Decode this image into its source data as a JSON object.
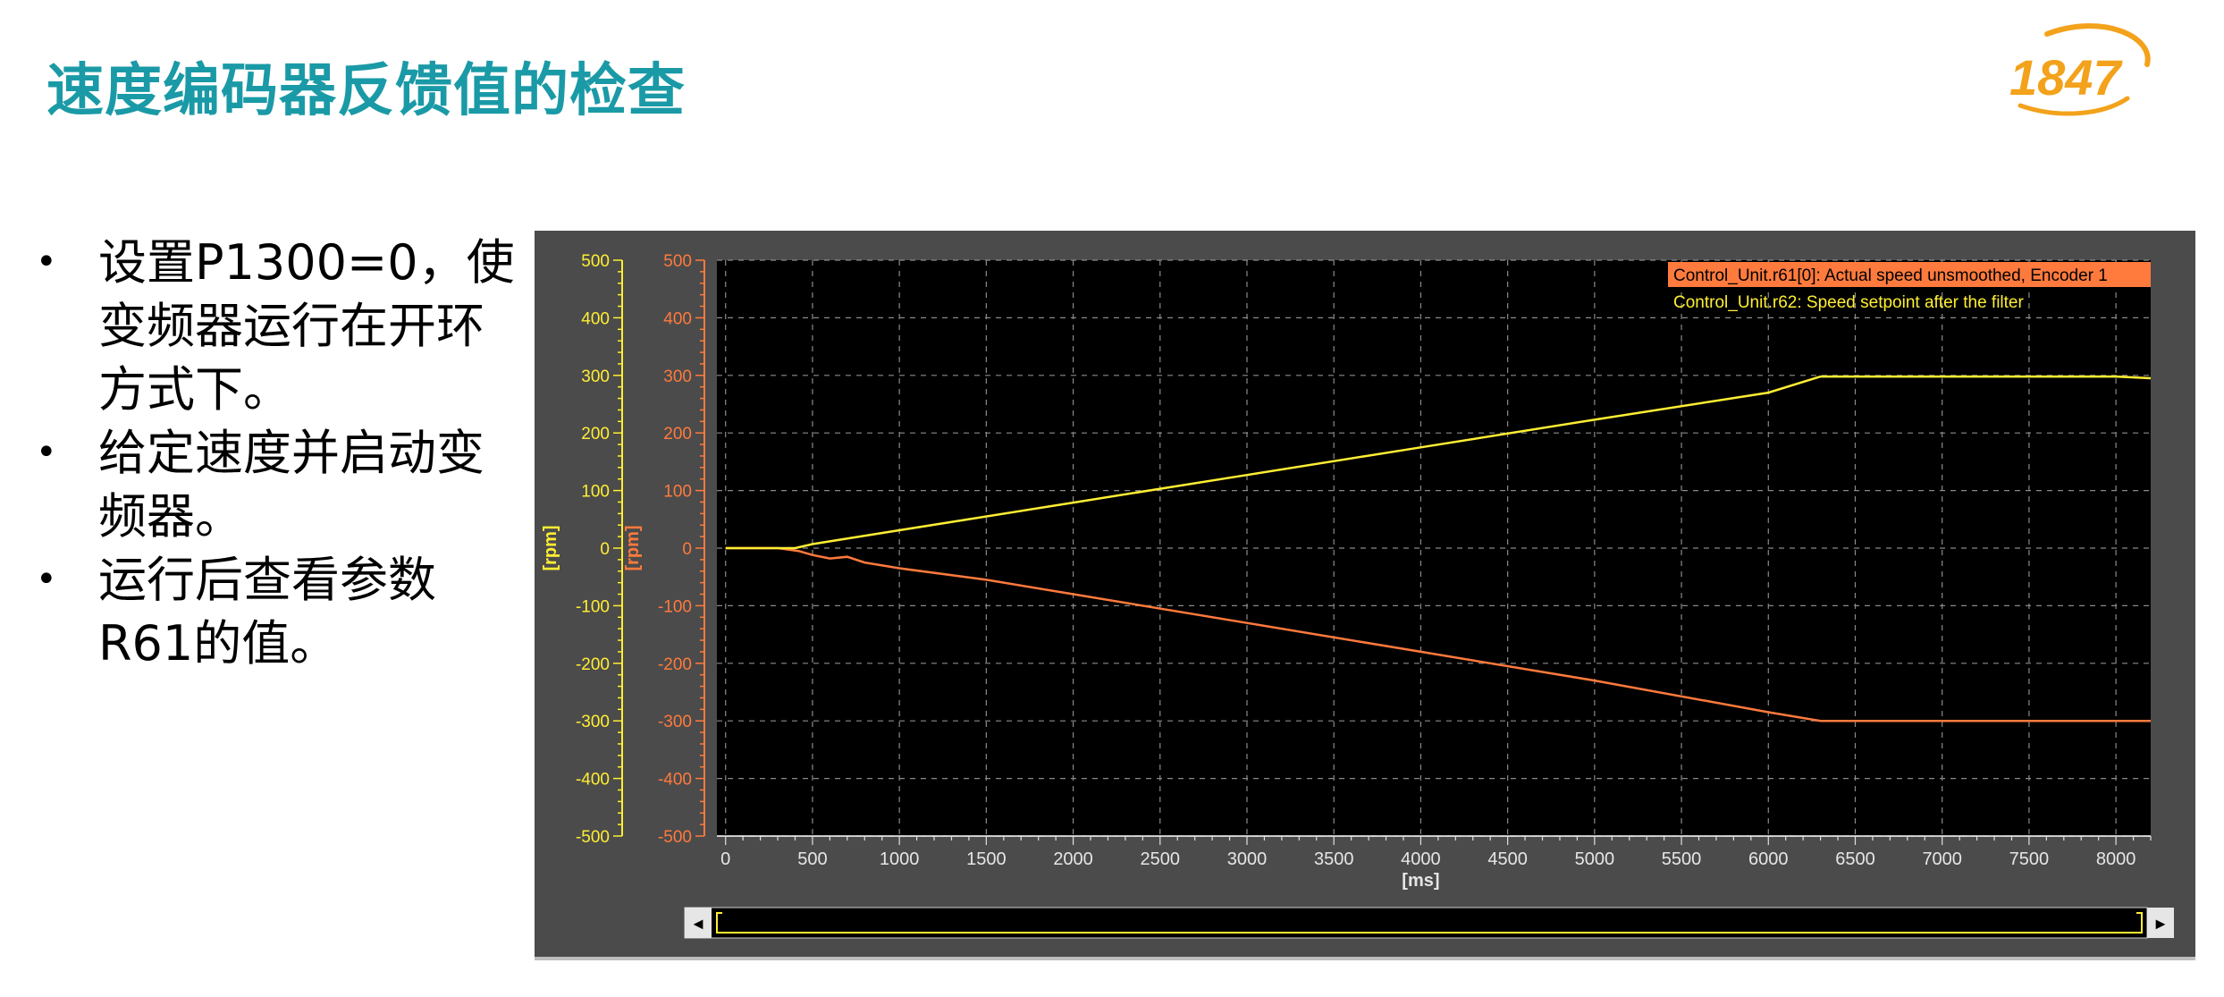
{
  "slide": {
    "title": "速度编码器反馈值的检查",
    "logo_text": "1847"
  },
  "bullets": [
    "设置P1300=0，使变频器运行在开环方式下。",
    "给定速度并启动变频器。",
    "运行后查看参数R61的值。"
  ],
  "bullet_lines": [
    [
      "设置P1300=0，使",
      "变频器运行在开环",
      "方式下。"
    ],
    [
      "给定速度并启动变",
      "频器。"
    ],
    [
      "运行后查看参数",
      "R61的值。"
    ]
  ],
  "colors": {
    "title": "#1a9aa6",
    "logo": "#f3a21b",
    "plot_bg": "#000000",
    "panel_bg": "#4b4b4b",
    "series_setpoint": "#ffee33",
    "series_actual": "#ff7a3d",
    "grid": "#8a8a8a"
  },
  "trace": {
    "unit_label": "[rpm]",
    "xaxis_label": "[ms]",
    "scroll_left": "◄",
    "scroll_right": "►"
  },
  "chart_data": {
    "type": "line",
    "xlabel": "[ms]",
    "ylabel": "[rpm]",
    "xlim": [
      -50,
      8200
    ],
    "ylim": [
      -500,
      500
    ],
    "xticks": [
      0,
      500,
      1000,
      1500,
      2000,
      2500,
      3000,
      3500,
      4000,
      4500,
      5000,
      5500,
      6000,
      6500,
      7000,
      7500,
      8000
    ],
    "yticks": [
      500,
      400,
      300,
      200,
      100,
      0,
      -100,
      -200,
      -300,
      -400,
      -500
    ],
    "grid": true,
    "legend_position": "top-right",
    "series": [
      {
        "name": "Control_Unit.r61[0]: Actual speed unsmoothed, Encoder 1",
        "color": "#ff7a3d",
        "x": [
          0,
          300,
          420,
          500,
          600,
          700,
          800,
          1000,
          1500,
          2000,
          3000,
          4000,
          5000,
          6000,
          6300,
          7000,
          8000,
          8200
        ],
        "y": [
          0,
          0,
          -5,
          -12,
          -18,
          -15,
          -25,
          -35,
          -55,
          -80,
          -130,
          -180,
          -230,
          -285,
          -300,
          -300,
          -300,
          -300
        ]
      },
      {
        "name": "Control_Unit.r62: Speed setpoint after the filter",
        "color": "#ffee33",
        "x": [
          0,
          400,
          500,
          1000,
          2000,
          3000,
          4000,
          5000,
          6000,
          6300,
          7000,
          8000,
          8200
        ],
        "y": [
          0,
          0,
          7,
          31,
          79,
          127,
          175,
          223,
          270,
          298,
          298,
          298,
          295
        ]
      }
    ]
  }
}
